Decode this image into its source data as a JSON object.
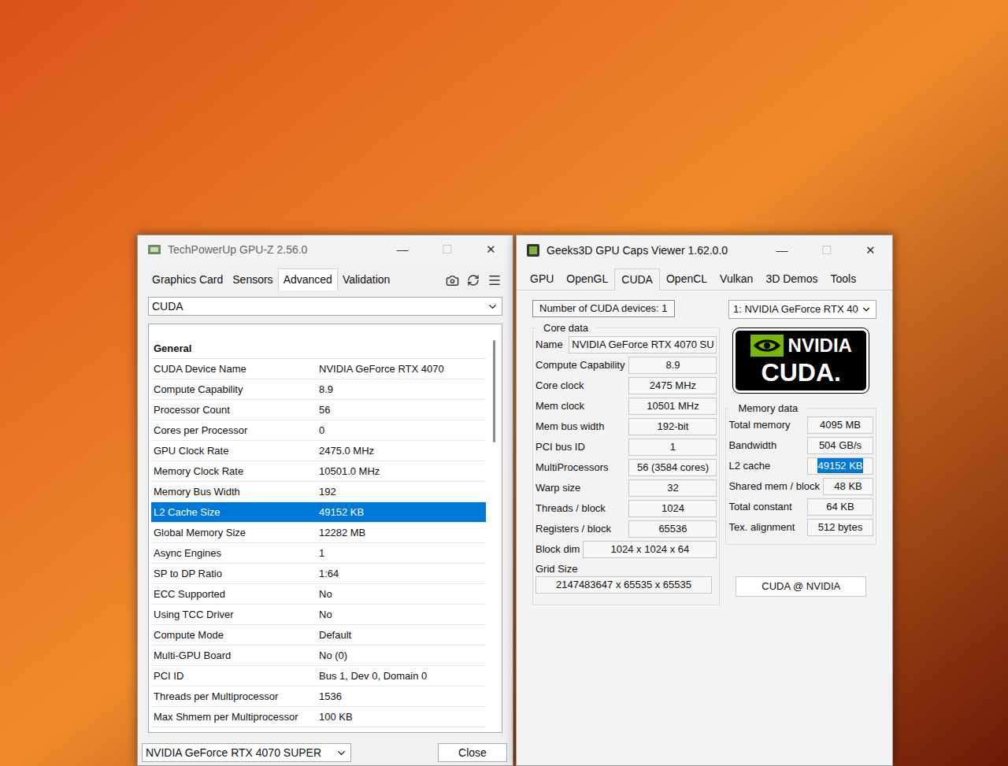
{
  "gpuz": {
    "title": "TechPowerUp GPU-Z 2.56.0",
    "controls": [
      {
        "symbol": "—",
        "disabled": false
      },
      {
        "symbol": "☐",
        "disabled": true
      },
      {
        "symbol": "✕",
        "disabled": false
      }
    ],
    "tabs": [
      {
        "label": "Graphics Card",
        "selected": false
      },
      {
        "label": "Sensors",
        "selected": false
      },
      {
        "label": "Advanced",
        "selected": true
      },
      {
        "label": "Validation",
        "selected": false
      }
    ],
    "api_select": "CUDA",
    "section": "General",
    "rows": [
      {
        "label": "CUDA Device Name",
        "value": "NVIDIA GeForce RTX 4070",
        "selected": false
      },
      {
        "label": "Compute Capability",
        "value": "8.9",
        "selected": false
      },
      {
        "label": "Processor Count",
        "value": "56",
        "selected": false
      },
      {
        "label": "Cores per Processor",
        "value": "0",
        "selected": false
      },
      {
        "label": "GPU Clock Rate",
        "value": "2475.0 MHz",
        "selected": false
      },
      {
        "label": "Memory Clock Rate",
        "value": "10501.0 MHz",
        "selected": false
      },
      {
        "label": "Memory Bus Width",
        "value": "192",
        "selected": false
      },
      {
        "label": "L2 Cache Size",
        "value": "49152 KB",
        "selected": true
      },
      {
        "label": "Global Memory Size",
        "value": "12282 MB",
        "selected": false
      },
      {
        "label": "Async Engines",
        "value": "1",
        "selected": false
      },
      {
        "label": "SP to DP Ratio",
        "value": "1:64",
        "selected": false
      },
      {
        "label": "ECC Supported",
        "value": "No",
        "selected": false
      },
      {
        "label": "Using TCC Driver",
        "value": "No",
        "selected": false
      },
      {
        "label": "Compute Mode",
        "value": "Default",
        "selected": false
      },
      {
        "label": "Multi-GPU Board",
        "value": "No (0)",
        "selected": false
      },
      {
        "label": "PCI ID",
        "value": "Bus 1, Dev 0, Domain 0",
        "selected": false
      },
      {
        "label": "Threads per Multiprocessor",
        "value": "1536",
        "selected": false
      },
      {
        "label": "Max Shmem per Multiprocessor",
        "value": "100 KB",
        "selected": false
      }
    ],
    "device_select": "NVIDIA GeForce RTX 4070 SUPER",
    "close_button": "Close"
  },
  "caps": {
    "title": "Geeks3D GPU Caps Viewer 1.62.0.0",
    "controls": [
      {
        "symbol": "—",
        "disabled": false
      },
      {
        "symbol": "☐",
        "disabled": true
      },
      {
        "symbol": "✕",
        "disabled": false
      }
    ],
    "tabs": [
      {
        "label": "GPU",
        "selected": false
      },
      {
        "label": "OpenGL",
        "selected": false
      },
      {
        "label": "CUDA",
        "selected": true
      },
      {
        "label": "OpenCL",
        "selected": false
      },
      {
        "label": "Vulkan",
        "selected": false
      },
      {
        "label": "3D Demos",
        "selected": false
      },
      {
        "label": "Tools",
        "selected": false
      }
    ],
    "device_count": "Number of CUDA devices: 1",
    "device_select": "1: NVIDIA GeForce RTX 40",
    "core_title": "Core data",
    "core_fields": [
      {
        "label": "Name",
        "value": "NVIDIA GeForce RTX 4070 SU",
        "kind": "wide"
      },
      {
        "label": "Compute Capability",
        "value": "8.9",
        "kind": "short"
      },
      {
        "label": "Core clock",
        "value": "2475 MHz",
        "kind": "short"
      },
      {
        "label": "Mem clock",
        "value": "10501 MHz",
        "kind": "short"
      },
      {
        "label": "Mem bus width",
        "value": "192-bit",
        "kind": "short"
      },
      {
        "label": "PCI bus ID",
        "value": "1",
        "kind": "short"
      },
      {
        "label": "MultiProcessors",
        "value": "56 (3584 cores)",
        "kind": "short"
      },
      {
        "label": "Warp size",
        "value": "32",
        "kind": "short"
      },
      {
        "label": "Threads / block",
        "value": "1024",
        "kind": "short"
      },
      {
        "label": "Registers / block",
        "value": "65536",
        "kind": "short"
      },
      {
        "label": "Block dim",
        "value": "1024 x 1024 x 64",
        "kind": "wide"
      },
      {
        "label": "Grid Size",
        "value": "2147483647 x 65535 x 65535",
        "kind": "stacked"
      }
    ],
    "logo": {
      "brand": "NVIDIA",
      "product": "CUDA."
    },
    "memory_title": "Memory data",
    "memory_fields": [
      {
        "label": "Total memory",
        "value": "4095 MB",
        "selected": false
      },
      {
        "label": "Bandwidth",
        "value": "504 GB/s",
        "selected": false
      },
      {
        "label": "L2 cache",
        "value": "49152 KB",
        "selected": true
      },
      {
        "label": "Shared mem / block",
        "value": "48 KB",
        "selected": false
      },
      {
        "label": "Total constant",
        "value": "64 KB",
        "selected": false
      },
      {
        "label": "Tex. alignment",
        "value": "512 bytes",
        "selected": false
      }
    ],
    "link_button": "CUDA @ NVIDIA"
  }
}
